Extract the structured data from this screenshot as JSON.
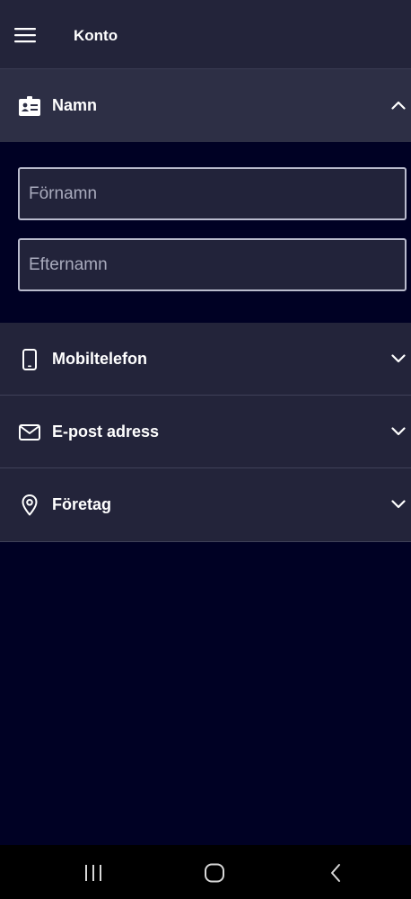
{
  "header": {
    "title": "Konto",
    "menu_icon": "hamburger-menu-icon"
  },
  "sections": {
    "name": {
      "label": "Namn",
      "icon": "id-card-icon",
      "expanded": true,
      "fields": {
        "first_name": {
          "value": "",
          "placeholder": "Förnamn"
        },
        "last_name": {
          "value": "",
          "placeholder": "Efternamn"
        }
      }
    },
    "mobile": {
      "label": "Mobiltelefon",
      "icon": "smartphone-icon",
      "expanded": false
    },
    "email": {
      "label": "E-post adress",
      "icon": "envelope-icon",
      "expanded": false
    },
    "company": {
      "label": "Företag",
      "icon": "location-pin-icon",
      "expanded": false
    }
  },
  "system_nav": {
    "buttons": [
      "recent-apps-icon",
      "home-icon",
      "back-icon"
    ]
  },
  "colors": {
    "background": "#000124",
    "header": "#23243a",
    "header_open": "#2d2f45",
    "field_border": "#b9bbcd",
    "text": "#ffffff",
    "placeholder": "#a9abbd"
  }
}
